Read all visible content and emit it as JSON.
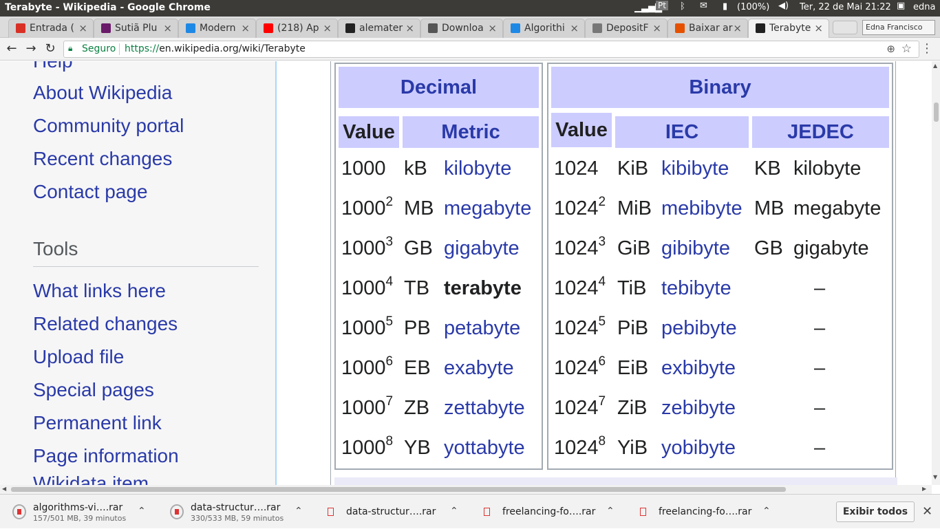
{
  "system_bar": {
    "window_title": "Terabyte - Wikipedia - Google Chrome",
    "keyboard_layout": "Pt",
    "battery": "(100%)",
    "datetime": "Ter, 22 de Mai 21:22",
    "user": "edna"
  },
  "tabs": [
    {
      "label": "Entrada (",
      "icon": "gmail-icon",
      "color": "#d93025"
    },
    {
      "label": "Sutiã Plu",
      "icon": "purple-m-icon",
      "color": "#6a1b6a"
    },
    {
      "label": "Modern",
      "icon": "p-logo-icon",
      "color": "#1e88e5"
    },
    {
      "label": "(218) Ap",
      "icon": "youtube-icon",
      "color": "#ff0000"
    },
    {
      "label": "alemater",
      "icon": "github-icon",
      "color": "#222222"
    },
    {
      "label": "Downloa",
      "icon": "download-icon",
      "color": "#555555"
    },
    {
      "label": "Algorithi",
      "icon": "p-logo-icon",
      "color": "#1e88e5"
    },
    {
      "label": "DepositF",
      "icon": "depositfiles-icon",
      "color": "#777777"
    },
    {
      "label": "Baixar ar",
      "icon": "layers-icon",
      "color": "#e65100"
    },
    {
      "label": "Terabyte",
      "icon": "wikipedia-icon",
      "color": "#222222",
      "active": true
    }
  ],
  "profile_button": "Edna Francisco",
  "address_bar": {
    "security_label": "Seguro",
    "url_scheme": "https://",
    "url_rest": "en.wikipedia.org/wiki/Terabyte"
  },
  "sidebar": {
    "partial_top": "Help",
    "links_top": [
      "About Wikipedia",
      "Community portal",
      "Recent changes",
      "Contact page"
    ],
    "tools_heading": "Tools",
    "tools_links": [
      "What links here",
      "Related changes",
      "Upload file",
      "Special pages",
      "Permanent link",
      "Page information"
    ],
    "partial_bottom": "Wikidata item"
  },
  "table": {
    "decimal_header": "Decimal",
    "binary_header": "Binary",
    "col_value": "Value",
    "col_metric": "Metric",
    "col_value_bin": "Value",
    "col_iec": "IEC",
    "col_jedec": "JEDEC",
    "rows": [
      {
        "dec_base": "1000",
        "dec_exp": "",
        "dec_sym": "kB",
        "dec_name": "kilobyte",
        "bin_base": "1024",
        "bin_exp": "",
        "iec_sym": "KiB",
        "iec_name": "kibibyte",
        "jedec_sym": "KB",
        "jedec_name": "kilobyte"
      },
      {
        "dec_base": "1000",
        "dec_exp": "2",
        "dec_sym": "MB",
        "dec_name": "megabyte",
        "bin_base": "1024",
        "bin_exp": "2",
        "iec_sym": "MiB",
        "iec_name": "mebibyte",
        "jedec_sym": "MB",
        "jedec_name": "megabyte"
      },
      {
        "dec_base": "1000",
        "dec_exp": "3",
        "dec_sym": "GB",
        "dec_name": "gigabyte",
        "bin_base": "1024",
        "bin_exp": "3",
        "iec_sym": "GiB",
        "iec_name": "gibibyte",
        "jedec_sym": "GB",
        "jedec_name": "gigabyte"
      },
      {
        "dec_base": "1000",
        "dec_exp": "4",
        "dec_sym": "TB",
        "dec_name": "terabyte",
        "bin_base": "1024",
        "bin_exp": "4",
        "iec_sym": "TiB",
        "iec_name": "tebibyte",
        "jedec_dash": "–"
      },
      {
        "dec_base": "1000",
        "dec_exp": "5",
        "dec_sym": "PB",
        "dec_name": "petabyte",
        "bin_base": "1024",
        "bin_exp": "5",
        "iec_sym": "PiB",
        "iec_name": "pebibyte",
        "jedec_dash": "–"
      },
      {
        "dec_base": "1000",
        "dec_exp": "6",
        "dec_sym": "EB",
        "dec_name": "exabyte",
        "bin_base": "1024",
        "bin_exp": "6",
        "iec_sym": "EiB",
        "iec_name": "exbibyte",
        "jedec_dash": "–"
      },
      {
        "dec_base": "1000",
        "dec_exp": "7",
        "dec_sym": "ZB",
        "dec_name": "zettabyte",
        "bin_base": "1024",
        "bin_exp": "7",
        "iec_sym": "ZiB",
        "iec_name": "zebibyte",
        "jedec_dash": "–"
      },
      {
        "dec_base": "1000",
        "dec_exp": "8",
        "dec_sym": "YB",
        "dec_name": "yottabyte",
        "bin_base": "1024",
        "bin_exp": "8",
        "iec_sym": "YiB",
        "iec_name": "yobibyte",
        "jedec_dash": "–"
      }
    ]
  },
  "downloads": [
    {
      "name": "algorithms-vi….rar",
      "status": "157/501 MB, 39 minutos"
    },
    {
      "name": "data-structur….rar",
      "status": "330/533 MB, 59 minutos"
    },
    {
      "name": "data-structur….rar",
      "status": ""
    },
    {
      "name": "freelancing-fo….rar",
      "status": ""
    },
    {
      "name": "freelancing-fo….rar",
      "status": ""
    }
  ],
  "show_all_label": "Exibir todos"
}
